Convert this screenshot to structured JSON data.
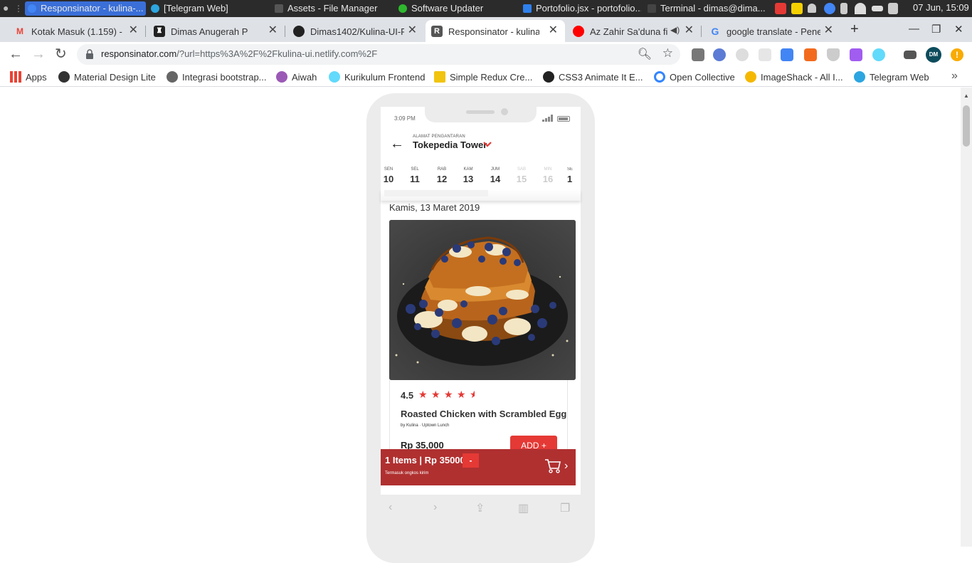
{
  "os_bar": {
    "tasks": [
      {
        "label": "Responsinator - kulina-...",
        "color": "#4285f4",
        "active": true
      },
      {
        "label": "[Telegram Web]",
        "color": "#2ca5e0",
        "active": false
      },
      {
        "label": "Assets - File Manager",
        "color": "#555555",
        "active": false
      },
      {
        "label": "Software Updater",
        "color": "#2eb82e",
        "active": false
      },
      {
        "label": "Portofolio.jsx - portofolio...",
        "color": "#2f80ed",
        "active": false
      },
      {
        "label": "Terminal - dimas@dima...",
        "color": "#444444",
        "active": false
      }
    ],
    "clock": "07 Jun, 15:09"
  },
  "tabs": [
    {
      "title": "Kotak Masuk (1.159) - a",
      "icon": "gmail-icon",
      "color": "#ea4335"
    },
    {
      "title": "Dimas Anugerah P",
      "icon": "castle-icon",
      "color": "#222222"
    },
    {
      "title": "Dimas1402/Kulina-UI-Pl",
      "icon": "github-icon",
      "color": "#222222"
    },
    {
      "title": "Responsinator - kulina-",
      "icon": "responsinator-icon",
      "color": "#666666",
      "active": true
    },
    {
      "title": "Az Zahir Sa'duna fi",
      "icon": "youtube-icon",
      "color": "#ff0000"
    },
    {
      "title": "google translate - Pene",
      "icon": "google-icon",
      "color": "#4285f4"
    }
  ],
  "address": {
    "domain": "responsinator.com",
    "path": "/?url=https%3A%2F%2Fkulina-ui.netlify.com%2F"
  },
  "bookmarks": [
    {
      "label": "Apps",
      "icon": "apps-grid-icon",
      "color": "#ea4335"
    },
    {
      "label": "Material Design Lite",
      "icon": "mdl-icon",
      "color": "#333333"
    },
    {
      "label": "Integrasi bootstrap...",
      "icon": "globe-icon",
      "color": "#555555"
    },
    {
      "label": "Aiwah",
      "icon": "aiwah-icon",
      "color": "#9b59b6"
    },
    {
      "label": "Kurikulum Frontend",
      "icon": "react-icon",
      "color": "#61dafb"
    },
    {
      "label": "Simple Redux Cre...",
      "icon": "pencil-icon",
      "color": "#f1c40f"
    },
    {
      "label": "CSS3 Animate It E...",
      "icon": "ninja-icon",
      "color": "#222222"
    },
    {
      "label": "Open Collective",
      "icon": "open-collective-icon",
      "color": "#3385ff"
    },
    {
      "label": "ImageShack - All I...",
      "icon": "imageshack-icon",
      "color": "#f5b800"
    },
    {
      "label": "Telegram Web",
      "icon": "telegram-icon",
      "color": "#2ca5e0"
    }
  ],
  "app": {
    "status_time": "3:09 PM",
    "address_label": "ALAMAT PENGANTARAN",
    "address_value": "Tokepedia Tower",
    "days": [
      {
        "name": "SEN",
        "date": "10",
        "enabled": true
      },
      {
        "name": "SEL",
        "date": "11",
        "enabled": true
      },
      {
        "name": "RAB",
        "date": "12",
        "enabled": true
      },
      {
        "name": "KAM",
        "date": "13",
        "enabled": true
      },
      {
        "name": "JUM",
        "date": "14",
        "enabled": true
      },
      {
        "name": "SAB",
        "date": "15",
        "enabled": false
      },
      {
        "name": "MIN",
        "date": "16",
        "enabled": false
      },
      {
        "name": "SE",
        "date": "1",
        "enabled": true
      }
    ],
    "date_heading": "Kamis, 13 Maret 2019",
    "food": {
      "rating": "4.5",
      "rating_value": 4.5,
      "name": "Roasted Chicken with Scrambled Egg",
      "by": "by Kulina · Uptown Lunch",
      "price": "Rp 35,000",
      "add_label": "ADD +"
    },
    "cart": {
      "summary": "1 Items | Rp 35000",
      "minus_label": "-",
      "note": "Termasuk ongkos kirim"
    }
  },
  "colors": {
    "accent_red": "#e53935",
    "cart_bg": "#b03030"
  }
}
